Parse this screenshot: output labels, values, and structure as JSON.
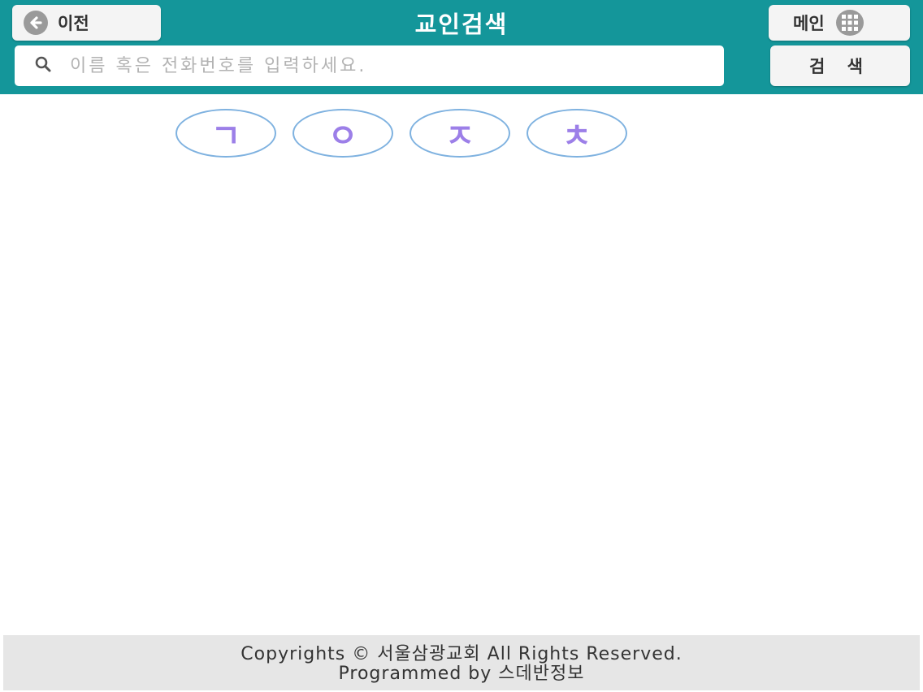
{
  "header": {
    "back_label": "이전",
    "title": "교인검색",
    "main_label": "메인",
    "search_button_label": "검 색",
    "search_placeholder": "이름 혹은 전화번호를 입력하세요."
  },
  "consonants": [
    "ㄱ",
    "ㅇ",
    "ㅈ",
    "ㅊ"
  ],
  "footer": {
    "line1": "Copyrights © 서울삼광교회 All Rights Reserved.",
    "line2": "Programmed by 스데반정보"
  },
  "colors": {
    "header_bg": "#14969a",
    "consonant_text": "#9c7fe8",
    "consonant_border": "#7fb2e0",
    "footer_bg": "#e6e6e6"
  },
  "icons": {
    "back": "arrow-left-circle-icon",
    "main": "grid-icon",
    "search": "search-icon"
  }
}
